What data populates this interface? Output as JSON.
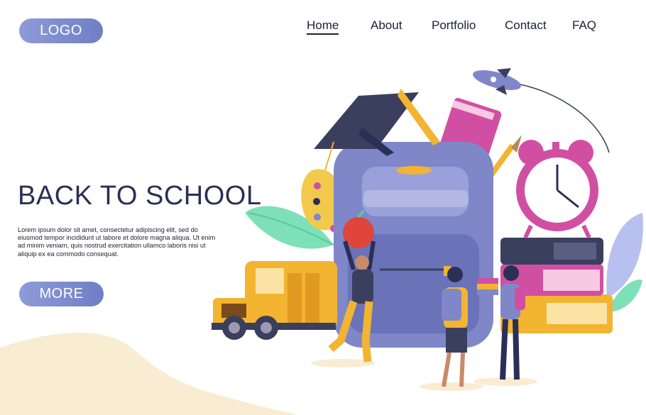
{
  "header": {
    "logo_label": "LOGO",
    "nav": [
      {
        "label": "Home",
        "active": true
      },
      {
        "label": "About",
        "active": false
      },
      {
        "label": "Portfolio",
        "active": false
      },
      {
        "label": "Contact",
        "active": false
      },
      {
        "label": "FAQ",
        "active": false
      }
    ]
  },
  "hero": {
    "title": "BACK TO SCHOOL",
    "body": "Lorem ipsum dolor sit amet, consectetur adipiscing elit, sed do eiusmod tempor incididunt ut labore et dolore magna aliqua. Ut enim ad minim veniam, quis nostrud exercitation ullamco laboris nisi ut aliquip ex ea commodo consequat.",
    "more_label": "MORE"
  },
  "colors": {
    "accent": "#7d8bd0",
    "title": "#2b2f55",
    "blob": "#f8ecd2",
    "backpack": "#7f87c9",
    "clock": "#d14fa3",
    "bus": "#f2b431",
    "leaf": "#7ee0b8"
  },
  "illustration": {
    "items": [
      "school-bus",
      "backpack",
      "graduation-cap",
      "book",
      "rocket",
      "alarm-clock",
      "book-stack",
      "palette",
      "paintbrush",
      "apple",
      "student-boy-with-apple",
      "student-boy-with-backpack",
      "student-girl-with-books",
      "leaves"
    ]
  }
}
